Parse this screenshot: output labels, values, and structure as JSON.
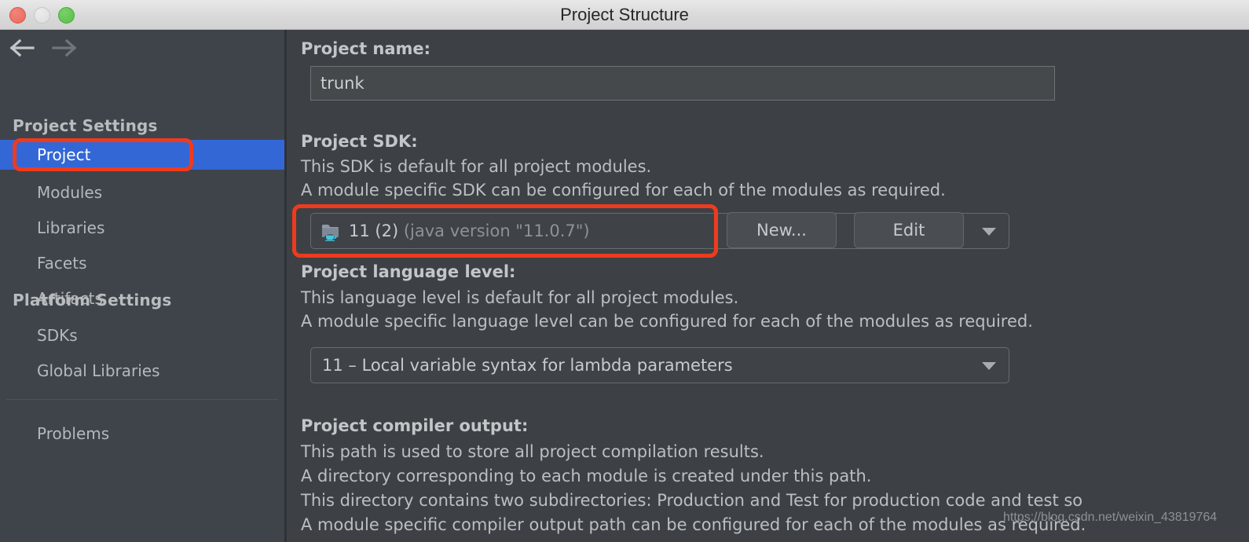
{
  "window": {
    "title": "Project Structure",
    "traffic_lights": [
      "close-red",
      "minimize-grey",
      "zoom-green"
    ]
  },
  "nav": {
    "back_icon": "arrow-left-icon",
    "forward_icon": "arrow-right-icon"
  },
  "sidebar": {
    "groups": [
      {
        "title": "Project Settings",
        "items": [
          {
            "label": "Project",
            "selected": true,
            "highlighted": true
          },
          {
            "label": "Modules",
            "selected": false
          },
          {
            "label": "Libraries",
            "selected": false
          },
          {
            "label": "Facets",
            "selected": false
          },
          {
            "label": "Artifacts",
            "selected": false
          }
        ]
      },
      {
        "title": "Platform Settings",
        "items": [
          {
            "label": "SDKs",
            "selected": false
          },
          {
            "label": "Global Libraries",
            "selected": false
          }
        ]
      }
    ],
    "extra_items": [
      {
        "label": "Problems",
        "selected": false
      }
    ]
  },
  "main": {
    "project_name": {
      "label": "Project name:",
      "value": "trunk"
    },
    "project_sdk": {
      "label": "Project SDK:",
      "desc1": "This SDK is default for all project modules.",
      "desc2": "A module specific SDK can be configured for each of the modules as required.",
      "selected_name": "11 (2)",
      "selected_detail": "(java version \"11.0.7\")",
      "icon": "jdk-folder-icon",
      "highlighted": true,
      "new_button": "New...",
      "edit_button": "Edit"
    },
    "project_language_level": {
      "label": "Project language level:",
      "desc1": "This language level is default for all project modules.",
      "desc2": "A module specific language level can be configured for each of the modules as required.",
      "value": "11 – Local variable syntax for lambda parameters"
    },
    "project_compiler_output": {
      "label": "Project compiler output:",
      "desc1": "This path is used to store all project compilation results.",
      "desc2": "A directory corresponding to each module is created under this path.",
      "desc3": "This directory contains two subdirectories: Production and Test for production code and test so",
      "desc4": "A module specific compiler output path can be configured for each of the modules as required."
    }
  },
  "watermark": {
    "text": "https://blog.csdn.net/weixin_43819764"
  },
  "colors": {
    "accent_selection": "#3367d6",
    "annotation_red": "#ee3b1e",
    "sidebar_bg": "#3f444a",
    "main_bg": "#3d4145",
    "titlebar_bg": "#dcdcdc"
  }
}
